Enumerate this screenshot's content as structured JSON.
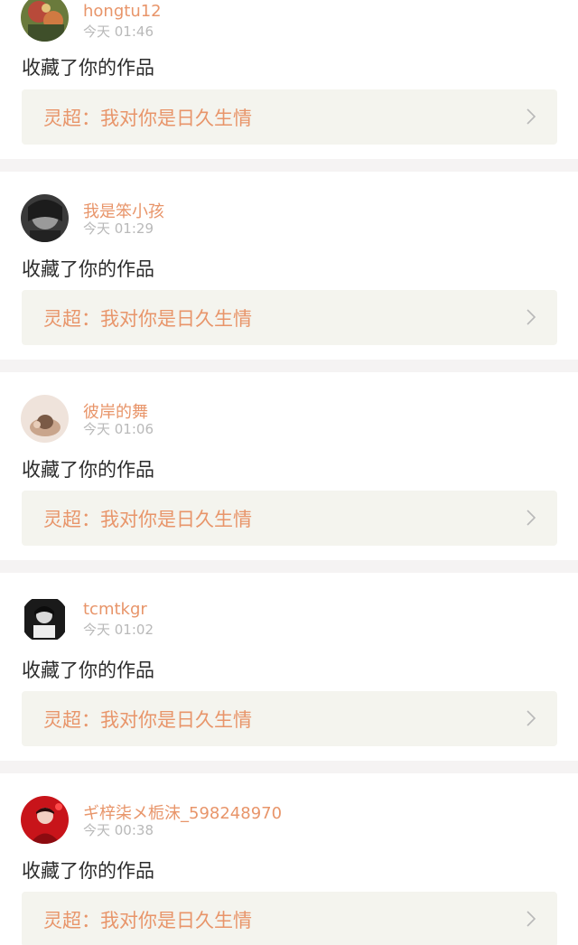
{
  "notifications": [
    {
      "username": "hongtu12",
      "time": "今天 01:46",
      "action": "收藏了你的作品",
      "work_title": "灵超：我对你是日久生情",
      "avatar_icon": "user-avatar-icon"
    },
    {
      "username": "我是笨小孩",
      "time": "今天 01:29",
      "action": "收藏了你的作品",
      "work_title": "灵超：我对你是日久生情",
      "avatar_icon": "user-avatar-icon"
    },
    {
      "username": "彼岸的舞",
      "time": "今天 01:06",
      "action": "收藏了你的作品",
      "work_title": "灵超：我对你是日久生情",
      "avatar_icon": "user-avatar-icon"
    },
    {
      "username": "tcmtkgr",
      "time": "今天 01:02",
      "action": "收藏了你的作品",
      "work_title": "灵超：我对你是日久生情",
      "avatar_icon": "user-avatar-icon"
    },
    {
      "username": "ギ梓柒メ栀沫_598248970",
      "time": "今天 00:38",
      "action": "收藏了你的作品",
      "work_title": "灵超：我对你是日久生情",
      "avatar_icon": "user-avatar-icon"
    }
  ],
  "colors": {
    "accent": "#e8956a",
    "time": "#b9b9b9",
    "text": "#2b2b2b",
    "link_bg": "#f4f4ee",
    "divider": "#f5f3f3"
  }
}
